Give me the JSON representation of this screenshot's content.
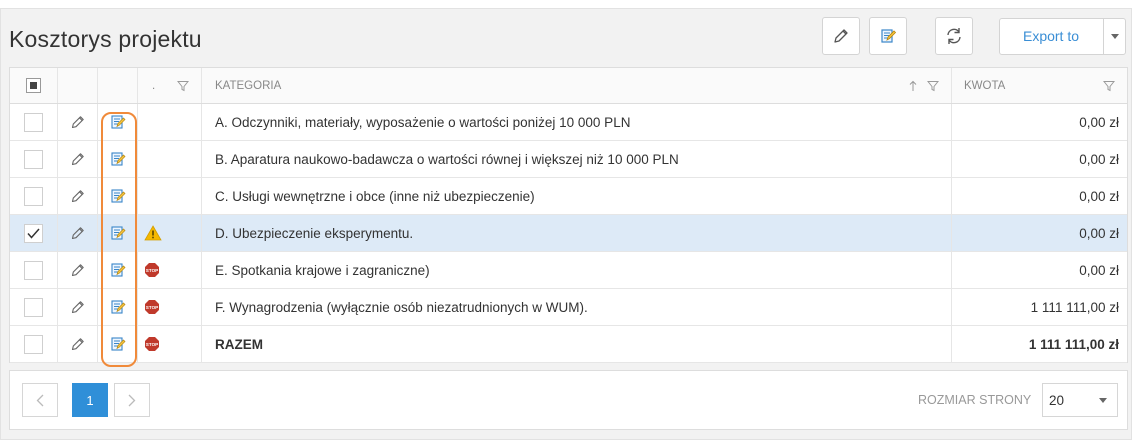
{
  "header": {
    "title": "Kosztorys projektu",
    "export_label": "Export to"
  },
  "columns": {
    "status_label": ".",
    "category_label": "KATEGORIA",
    "amount_label": "KWOTA"
  },
  "rows": [
    {
      "category": "A. Odczynniki, materiały, wyposażenie o wartości poniżej 10 000 PLN",
      "amount": "0,00 zł",
      "checked": false,
      "status": "none"
    },
    {
      "category": "B. Aparatura naukowo-badawcza o wartości równej i większej niż 10 000 PLN",
      "amount": "0,00 zł",
      "checked": false,
      "status": "none"
    },
    {
      "category": "C. Usługi wewnętrzne i obce (inne niż ubezpieczenie)",
      "amount": "0,00 zł",
      "checked": false,
      "status": "none"
    },
    {
      "category": "D. Ubezpieczenie eksperymentu.",
      "amount": "0,00 zł",
      "checked": true,
      "status": "warning-icon"
    },
    {
      "category": "E. Spotkania krajowe i zagraniczne)",
      "amount": "0,00 zł",
      "checked": false,
      "status": "stop-icon"
    },
    {
      "category": "F. Wynagrodzenia (wyłącznie osób niezatrudnionych w WUM).",
      "amount": "1 111 111,00 zł",
      "checked": false,
      "status": "stop-icon"
    },
    {
      "category": "RAZEM",
      "amount": "1 111 111,00 zł",
      "checked": false,
      "status": "stop-icon",
      "bold": true
    }
  ],
  "pager": {
    "current_page": "1",
    "page_size_label": "ROZMIAR STRONY",
    "page_size": "20"
  },
  "colors": {
    "accent": "#2f8fd8",
    "selected_row": "#ddeaf7",
    "highlight": "#f08a3a",
    "warning": "#f5b800",
    "stop": "#c0392b"
  }
}
